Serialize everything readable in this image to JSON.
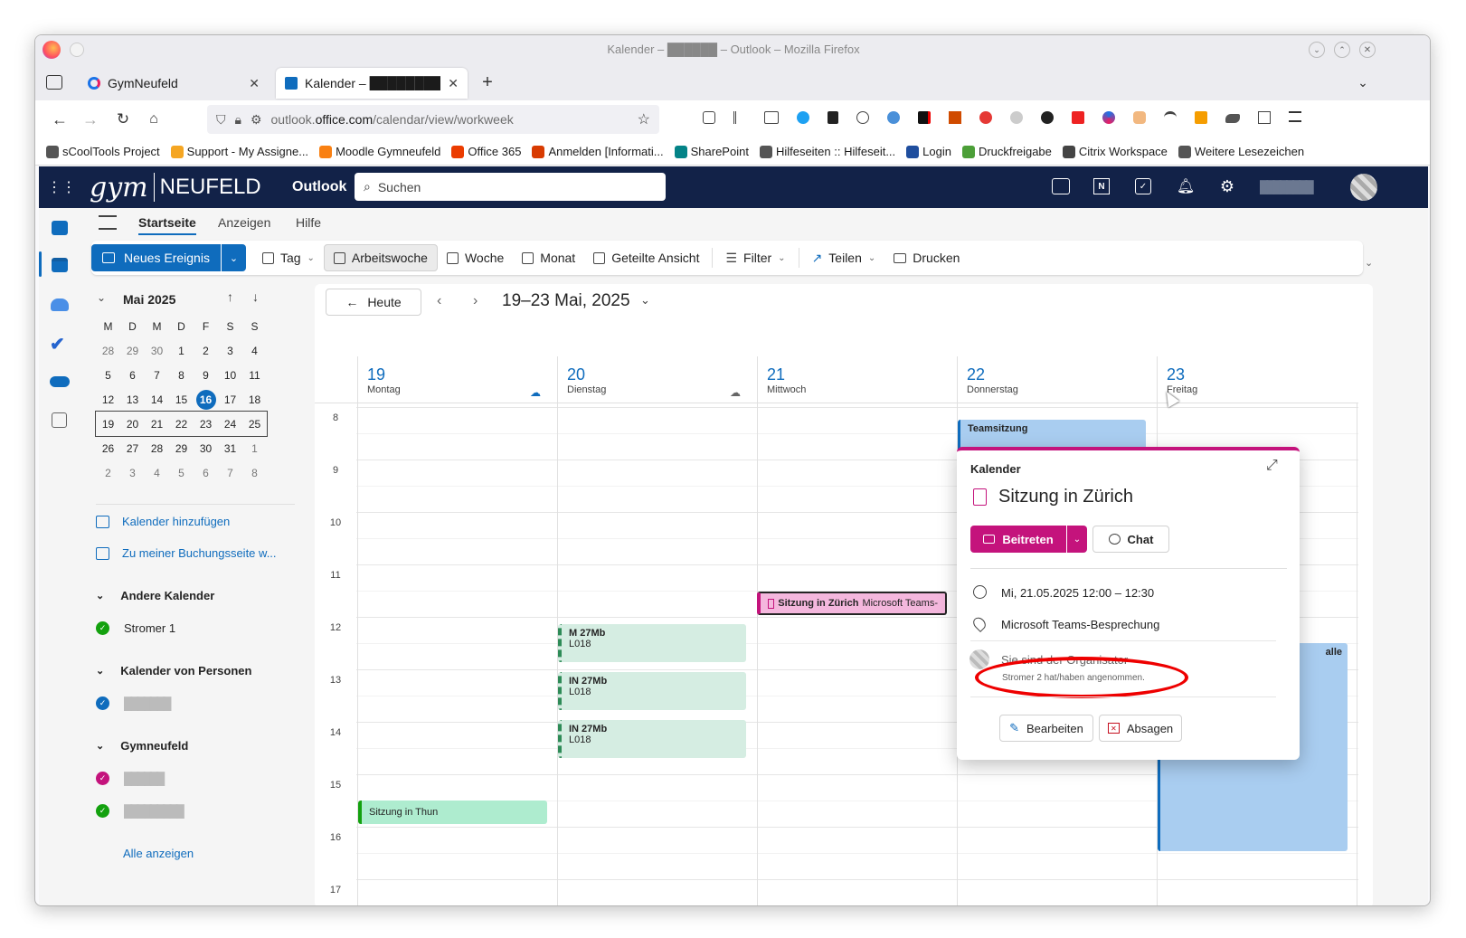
{
  "window": {
    "title": "Kalender – ██████ – Outlook – Mozilla Firefox"
  },
  "tabs": [
    {
      "label": "GymNeufeld"
    },
    {
      "label": "Kalender – ████████"
    }
  ],
  "url": {
    "prefix": "outlook.",
    "domain": "office.com",
    "path": "/calendar/view/workweek"
  },
  "bookmarks": [
    {
      "label": "sCoolTools Project",
      "color": "#555"
    },
    {
      "label": "Support - My Assigne...",
      "color": "#f5a623"
    },
    {
      "label": "Moodle Gymneufeld",
      "color": "#f98012"
    },
    {
      "label": "Office 365",
      "color": "#eb3c00"
    },
    {
      "label": "Anmelden [Informati...",
      "color": "#d83b01"
    },
    {
      "label": "SharePoint",
      "color": "#038387"
    },
    {
      "label": "Hilfeseiten :: Hilfeseit...",
      "color": "#555"
    },
    {
      "label": "Login",
      "color": "#1f4e9e"
    },
    {
      "label": "Druckfreigabe",
      "color": "#4c9f38"
    },
    {
      "label": "Citrix Workspace",
      "color": "#444"
    },
    {
      "label": "Weitere Lesezeichen",
      "color": "#555"
    }
  ],
  "header": {
    "logo_main": "gym",
    "logo_sub": "NEUFELD",
    "app": "Outlook",
    "search_placeholder": "Suchen",
    "user_blur": "████████"
  },
  "ribbon_tabs": [
    "Startseite",
    "Anzeigen",
    "Hilfe"
  ],
  "commands": {
    "new_event": "Neues Ereignis",
    "day": "Tag",
    "workweek": "Arbeitswoche",
    "week": "Woche",
    "month": "Monat",
    "split": "Geteilte Ansicht",
    "filter": "Filter",
    "share": "Teilen",
    "print": "Drucken"
  },
  "mini_cal": {
    "title": "Mai 2025",
    "weekdays": [
      "M",
      "D",
      "M",
      "D",
      "F",
      "S",
      "S"
    ],
    "weeks": [
      [
        "28",
        "29",
        "30",
        "1",
        "2",
        "3",
        "4"
      ],
      [
        "5",
        "6",
        "7",
        "8",
        "9",
        "10",
        "11"
      ],
      [
        "12",
        "13",
        "14",
        "15",
        "16",
        "17",
        "18"
      ],
      [
        "19",
        "20",
        "21",
        "22",
        "23",
        "24",
        "25"
      ],
      [
        "26",
        "27",
        "28",
        "29",
        "30",
        "31",
        "1"
      ],
      [
        "2",
        "3",
        "4",
        "5",
        "6",
        "7",
        "8"
      ]
    ],
    "today": "16"
  },
  "sidebar": {
    "add_calendar": "Kalender hinzufügen",
    "booking": "Zu meiner Buchungsseite w...",
    "other_cals": "Andere Kalender",
    "stromer": "Stromer 1",
    "people_cals": "Kalender von Personen",
    "person_blur": "███████",
    "gym": "Gymneufeld",
    "gym1_blur": "██████",
    "gym2_blur": "█████████",
    "show_all": "Alle anzeigen",
    "colors": {
      "stromer": "#13a10e",
      "person": "#0f6cbd",
      "gym1": "#c4137c",
      "gym2": "#13a10e"
    }
  },
  "calendar": {
    "today_btn": "Heute",
    "range": "19–23 Mai, 2025",
    "days": [
      {
        "num": "19",
        "name": "Montag"
      },
      {
        "num": "20",
        "name": "Dienstag"
      },
      {
        "num": "21",
        "name": "Mittwoch"
      },
      {
        "num": "22",
        "name": "Donnerstag"
      },
      {
        "num": "23",
        "name": "Freitag"
      }
    ],
    "hours": [
      "8",
      "9",
      "10",
      "11",
      "12",
      "13",
      "14",
      "15",
      "16",
      "17"
    ],
    "events": {
      "team": "Teamsitzung",
      "zurich_title": "Sitzung in Zürich",
      "zurich_loc": "Microsoft Teams-",
      "m27_title": "M 27Mb",
      "m27_room": "L018",
      "in27a_title": "IN 27Mb",
      "in27a_room": "L018",
      "in27b_title": "IN 27Mb",
      "in27b_room": "L018",
      "thun": "Sitzung in Thun",
      "fri_partial": "alle"
    }
  },
  "popup": {
    "calendar": "Kalender",
    "title": "Sitzung in Zürich",
    "join": "Beitreten",
    "chat": "Chat",
    "datetime": "Mi, 21.05.2025 12:00 – 12:30",
    "location": "Microsoft Teams-Besprechung",
    "organizer": "Sie sind der Organisator",
    "accepted": "Stromer 2 hat/haben angenommen.",
    "edit": "Bearbeiten",
    "decline": "Absagen"
  }
}
